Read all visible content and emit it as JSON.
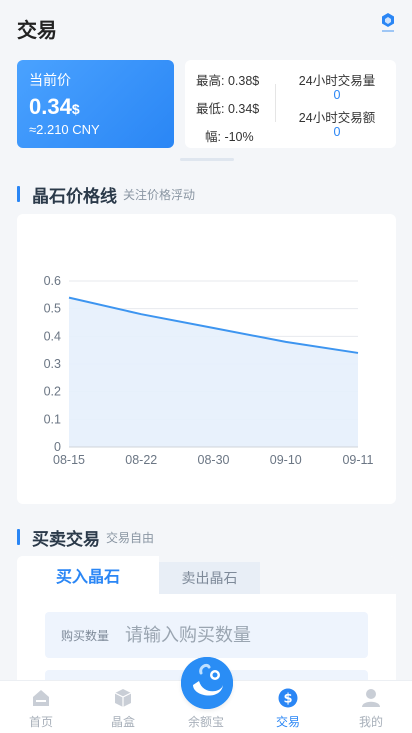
{
  "header": {
    "title": "交易",
    "logo_icon": "crystal-logo-icon"
  },
  "price_card": {
    "label": "当前价",
    "value": "0.34",
    "unit": "$",
    "cny": "≈2.210 CNY"
  },
  "stats": {
    "high": "最高: 0.38$",
    "low": "最低: 0.34$",
    "change": "幅: -10%",
    "volume_label": "24小时交易量",
    "volume_value": "0",
    "amount_label": "24小时交易额",
    "amount_value": "0"
  },
  "chart_section": {
    "title": "晶石价格线",
    "subtitle": "关注价格浮动"
  },
  "chart_data": {
    "type": "area",
    "categories": [
      "08-15",
      "08-22",
      "08-30",
      "09-10",
      "09-11"
    ],
    "values": [
      0.54,
      0.48,
      0.43,
      0.38,
      0.34
    ],
    "title": "",
    "xlabel": "",
    "ylabel": "",
    "ylim": [
      0,
      0.6
    ],
    "yticks": [
      "0",
      "0.1",
      "0.2",
      "0.3",
      "0.4",
      "0.5",
      "0.6"
    ],
    "grid": true,
    "line_color": "#3d95f0",
    "fill_color": "#e6f0fc"
  },
  "trade_section": {
    "title": "买卖交易",
    "subtitle": "交易自由"
  },
  "trade": {
    "tab_buy": "买入晶石",
    "tab_sell": "卖出晶石",
    "qty_label": "购买数量",
    "qty_placeholder": "请输入购买数量"
  },
  "tabbar": {
    "items": [
      {
        "label": "首页",
        "icon": "home-icon"
      },
      {
        "label": "晶盒",
        "icon": "box-icon"
      },
      {
        "label": "余额宝",
        "icon": "wallet-logo-icon"
      },
      {
        "label": "交易",
        "icon": "dollar-icon"
      },
      {
        "label": "我的",
        "icon": "user-icon"
      }
    ],
    "active_index": 3
  },
  "colors": {
    "accent": "#2a86f5",
    "background": "#f4f6f9"
  }
}
